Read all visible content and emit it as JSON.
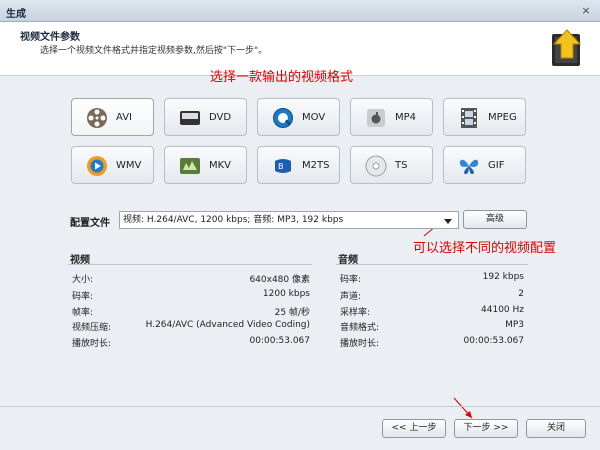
{
  "window": {
    "title": "生成",
    "close_glyph": "×"
  },
  "header": {
    "title": "视频文件参数",
    "subtitle": "选择一个视频文件格式并指定视频参数,然后按\"下一步\"。"
  },
  "annotations": {
    "top": "选择一款输出的视频格式",
    "right": "可以选择不同的视频配置"
  },
  "formats": [
    {
      "label": "AVI",
      "icon": "film-reel-icon",
      "selected": true
    },
    {
      "label": "DVD",
      "icon": "dvd-icon"
    },
    {
      "label": "MOV",
      "icon": "quicktime-icon"
    },
    {
      "label": "MP4",
      "icon": "apple-icon"
    },
    {
      "label": "MPEG",
      "icon": "film-strip-icon"
    },
    {
      "label": "WMV",
      "icon": "media-player-icon"
    },
    {
      "label": "MKV",
      "icon": "mkv-icon"
    },
    {
      "label": "M2TS",
      "icon": "bluray-icon"
    },
    {
      "label": "TS",
      "icon": "disc-icon"
    },
    {
      "label": "GIF",
      "icon": "butterfly-icon"
    }
  ],
  "profile": {
    "label": "配置文件",
    "value": "视频: H.264/AVC, 1200 kbps; 音频: MP3, 192 kbps",
    "advanced_button": "高级"
  },
  "video": {
    "title": "视频",
    "rows": [
      {
        "label": "大小:",
        "value": "640x480 像素"
      },
      {
        "label": "码率:",
        "value": "1200 kbps"
      },
      {
        "label": "帧率:",
        "value": "25 帧/秒"
      },
      {
        "label": "视频压缩:",
        "value": "H.264/AVC (Advanced Video Coding)"
      },
      {
        "label": "播放时长:",
        "value": "00:00:53.067"
      }
    ]
  },
  "audio": {
    "title": "音频",
    "rows": [
      {
        "label": "码率:",
        "value": "192 kbps"
      },
      {
        "label": "声道:",
        "value": "2"
      },
      {
        "label": "采样率:",
        "value": "44100 Hz"
      },
      {
        "label": "音频格式:",
        "value": "MP3"
      },
      {
        "label": "播放时长:",
        "value": "00:00:53.067"
      }
    ]
  },
  "footer": {
    "prev": "<< 上一步",
    "next": "下一步 >>",
    "close": "关闭"
  }
}
